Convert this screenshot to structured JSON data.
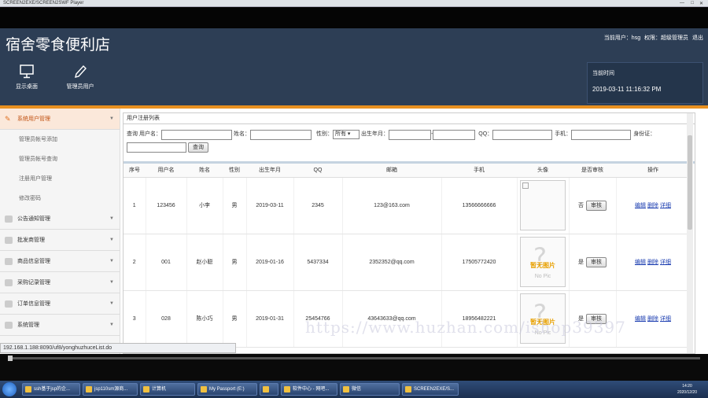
{
  "player": {
    "title": "SCREEN2EXE/SCREEN2SWF Player"
  },
  "app": {
    "brand": "宿舍零食便利店",
    "user_info": "当前用户：hsg",
    "role": "权限：超级管理员",
    "logout": "退出",
    "time_label": "当前时间",
    "time_value": "2019-03-11 11:16:32 PM"
  },
  "toolbar": [
    {
      "label": "显示桌面",
      "icon": "monitor-icon"
    },
    {
      "label": "管理员用户",
      "icon": "pencil-icon"
    }
  ],
  "sidebar": {
    "active": "系统用户管理",
    "subitems": [
      "管理员帐号添加",
      "管理员帐号查询",
      "注册用户管理",
      "修改密码"
    ],
    "sections": [
      "公告通知管理",
      "批发商管理",
      "商品信息管理",
      "采购记录管理",
      "订单信息管理",
      "系统管理"
    ]
  },
  "panel_title": "用户注册列表",
  "search": {
    "query_label": "查询",
    "username_label": "用户名：",
    "name_label": "姓名：",
    "gender_label": "性别：",
    "gender_value": "所有",
    "birth_label": "出生年月：",
    "qq_label": "QQ：",
    "phone_label": "手机：",
    "id_label": "身份证：",
    "button": "查询"
  },
  "table": {
    "headers": [
      "序号",
      "用户名",
      "姓名",
      "性别",
      "出生年月",
      "QQ",
      "邮箱",
      "手机",
      "头像",
      "是否审核",
      "操作"
    ],
    "rows": [
      {
        "no": "1",
        "user": "123456",
        "name": "小李",
        "gender": "男",
        "birth": "2019-03-11",
        "qq": "2345",
        "email": "123@163.com",
        "phone": "13566666666",
        "approved": "否"
      },
      {
        "no": "2",
        "user": "001",
        "name": "赵小聪",
        "gender": "男",
        "birth": "2019-01-16",
        "qq": "5437334",
        "email": "2352352@qq.com",
        "phone": "17505772420",
        "approved": "是"
      },
      {
        "no": "3",
        "user": "028",
        "name": "陈小巧",
        "gender": "男",
        "birth": "2019-01-31",
        "qq": "25454766",
        "email": "43643633@qq.com",
        "phone": "18956482221",
        "approved": "是"
      }
    ],
    "review_button": "审核",
    "ops": [
      "编辑",
      "删除",
      "详细"
    ],
    "placeholder_caption": "暂无图片",
    "placeholder_np": "No Pic"
  },
  "status_url": "192.168.1.188:8090/uf8/yonghuzhuceList.do",
  "watermark": "https://www.huzhan.com/ishop39397",
  "taskbar": {
    "items": [
      "ssh基于jsp的企...",
      "jsp110sm源商...",
      "计算机",
      "My Passport (E:)",
      "",
      "软件中心 - 网吧...",
      "微信",
      "SCREEN2EXE/S..."
    ],
    "time": "14:20",
    "date": "2020/12/20"
  }
}
